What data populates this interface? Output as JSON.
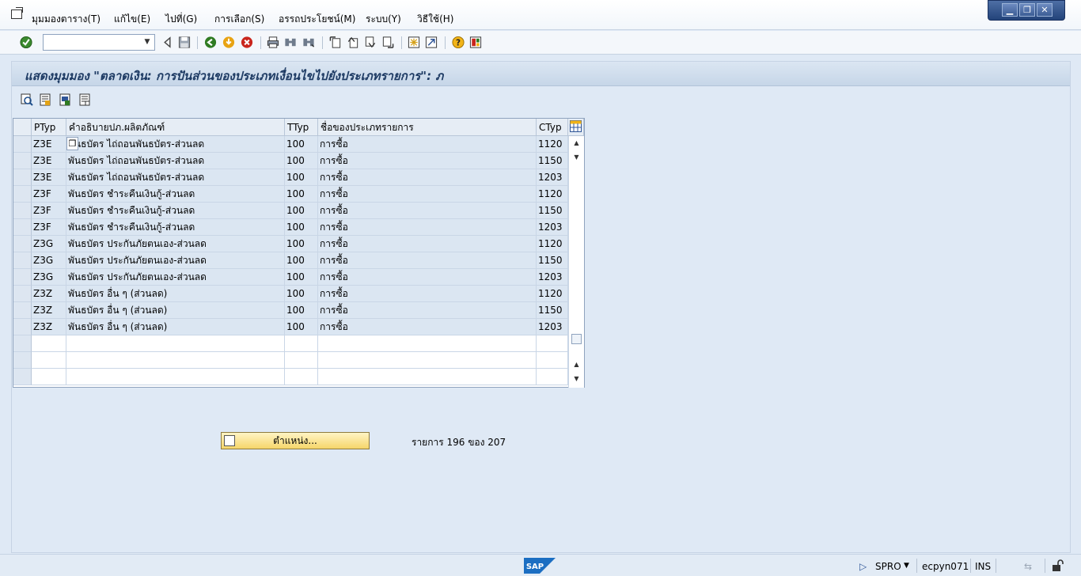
{
  "menu": {
    "items": [
      "มุมมองตาราง(T)",
      "แก้ไข(E)",
      "ไปที่(G)",
      "การเลือก(S)",
      "อรรถประโยชน์(M)",
      "ระบบ(Y)",
      "วิธีใช้(H)"
    ]
  },
  "window_controls": {
    "minimize": "▁",
    "restore": "❐",
    "close": "✕"
  },
  "toolbar": {
    "command_field_value": "",
    "icons": [
      "enter-icon",
      "back-icon",
      "save-icon",
      "green-back-icon",
      "exit-icon",
      "cancel-icon",
      "print-icon",
      "find-icon",
      "find-next-icon",
      "first-page-icon",
      "previous-page-icon",
      "next-page-icon",
      "last-page-icon",
      "create-session-icon",
      "shortcut-icon",
      "help-icon",
      "customize-layout-icon"
    ]
  },
  "page": {
    "title": "แสดงมุมมอง \"ตลาดเงิน: การปันส่วนของประเภทเงื่อนไขไปยังประเภทรายการ\": ภ",
    "app_toolbar_icons": [
      "details-icon",
      "select-all-icon",
      "select-block-icon",
      "deselect-all-icon"
    ]
  },
  "table": {
    "columns": [
      "PTyp",
      "คำอธิบายปภ.ผลิตภัณฑ์",
      "TTyp",
      "ชื่อของประเภทรายการ",
      "CTyp"
    ],
    "rows": [
      [
        "Z3E",
        "พันธบัตร ไถ่ถอนพันธบัตร-ส่วนลด",
        "100",
        "การซื้อ",
        "1120"
      ],
      [
        "Z3E",
        "พันธบัตร ไถ่ถอนพันธบัตร-ส่วนลด",
        "100",
        "การซื้อ",
        "1150"
      ],
      [
        "Z3E",
        "พันธบัตร ไถ่ถอนพันธบัตร-ส่วนลด",
        "100",
        "การซื้อ",
        "1203"
      ],
      [
        "Z3F",
        "พันธบัตร ชำระคืนเงินกู้-ส่วนลด",
        "100",
        "การซื้อ",
        "1120"
      ],
      [
        "Z3F",
        "พันธบัตร ชำระคืนเงินกู้-ส่วนลด",
        "100",
        "การซื้อ",
        "1150"
      ],
      [
        "Z3F",
        "พันธบัตร ชำระคืนเงินกู้-ส่วนลด",
        "100",
        "การซื้อ",
        "1203"
      ],
      [
        "Z3G",
        "พันธบัตร ประกันภัยตนเอง-ส่วนลด",
        "100",
        "การซื้อ",
        "1120"
      ],
      [
        "Z3G",
        "พันธบัตร ประกันภัยตนเอง-ส่วนลด",
        "100",
        "การซื้อ",
        "1150"
      ],
      [
        "Z3G",
        "พันธบัตร ประกันภัยตนเอง-ส่วนลด",
        "100",
        "การซื้อ",
        "1203"
      ],
      [
        "Z3Z",
        "พันธบัตร อื่น ๆ (ส่วนลด)",
        "100",
        "การซื้อ",
        "1120"
      ],
      [
        "Z3Z",
        "พันธบัตร อื่น ๆ (ส่วนลด)",
        "100",
        "การซื้อ",
        "1150"
      ],
      [
        "Z3Z",
        "พันธบัตร อื่น ๆ (ส่วนลด)",
        "100",
        "การซื้อ",
        "1203"
      ]
    ],
    "empty_rows": 3
  },
  "footer": {
    "position_button": "ตำแหน่ง...",
    "entry_count": "รายการ 196 ของ 207"
  },
  "statusbar": {
    "logo": "SAP",
    "transaction": "SPRO",
    "server": "ecpyn071",
    "mode": "INS"
  },
  "colors": {
    "background": "#dfe9f5",
    "title_text": "#1d3a63",
    "cell_background": "#dbe6f2",
    "button_yellow": "#f6d66a",
    "sap_blue": "#1b6ec2"
  }
}
